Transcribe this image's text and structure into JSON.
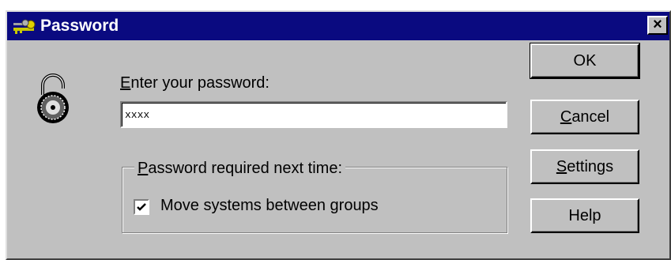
{
  "window": {
    "title": "Password",
    "close_label": "×"
  },
  "prompt": {
    "label": "Enter your password:",
    "label_mnemonic": "E",
    "label_rest": "nter your password:"
  },
  "password_field": {
    "value": "xxxx"
  },
  "group": {
    "legend": "Password required next time:",
    "legend_mnemonic": "P",
    "legend_rest": "assword required next time:",
    "checkbox_label": "Move systems between groups",
    "checked": true
  },
  "buttons": {
    "ok": "OK",
    "cancel_mnemonic": "C",
    "cancel_rest": "ancel",
    "settings_mnemonic": "S",
    "settings_rest": "ettings",
    "help": "Help"
  },
  "colors": {
    "titlebar": "#0a0a80",
    "face": "#c0c0c0"
  },
  "icons": {
    "app": "keys-icon",
    "lock": "padlock-icon",
    "close": "close-icon",
    "check": "checkmark-icon"
  }
}
